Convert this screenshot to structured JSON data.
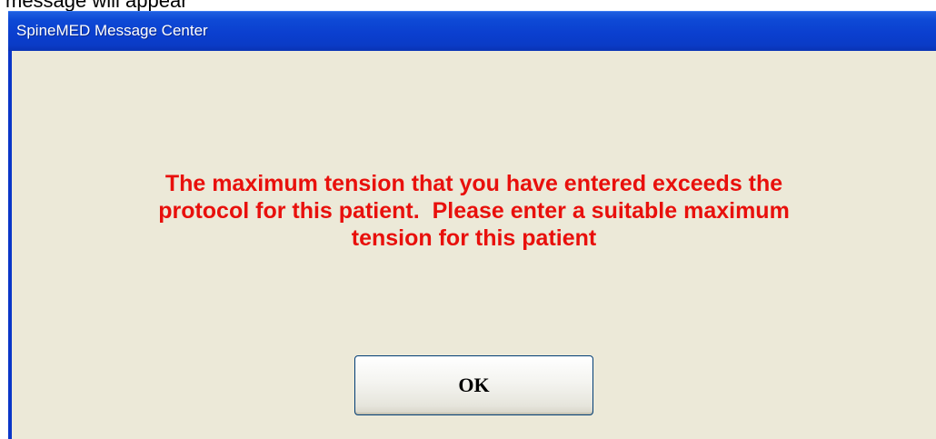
{
  "caption": "message will appear",
  "window": {
    "title": "SpineMED Message Center"
  },
  "dialog": {
    "message_lines": [
      "The maximum tension that you have entered exceeds the",
      "protocol for this patient.  Please enter a suitable maximum",
      "tension for this patient"
    ],
    "ok_label": "OK"
  },
  "colors": {
    "titlebar": "#0b3fcf",
    "client_background": "#ece9d8",
    "message_text": "#e8100c"
  }
}
